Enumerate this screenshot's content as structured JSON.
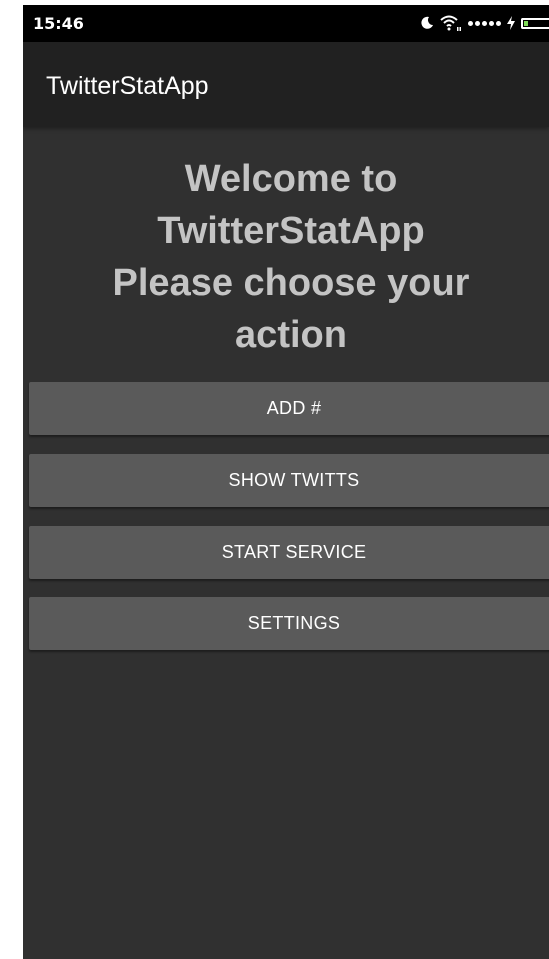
{
  "status_bar": {
    "time": "15:46",
    "icons": [
      "moon-icon",
      "wifi-icon",
      "signal-dots-icon",
      "charging-icon",
      "battery-icon"
    ]
  },
  "app_bar": {
    "title": "TwitterStatApp"
  },
  "main": {
    "welcome_line1": "Welcome to",
    "welcome_line2": "TwitterStatApp",
    "welcome_line3": "Please choose your",
    "welcome_line4": "action",
    "buttons": [
      {
        "label": "ADD #"
      },
      {
        "label": "SHOW TWITTS"
      },
      {
        "label": "START SERVICE"
      },
      {
        "label": "SETTINGS"
      }
    ]
  },
  "colors": {
    "background": "#303030",
    "app_bar": "#212121",
    "button": "#5a5a5a",
    "welcome_text": "#c4c4c4",
    "battery_fill": "#7ed957"
  }
}
